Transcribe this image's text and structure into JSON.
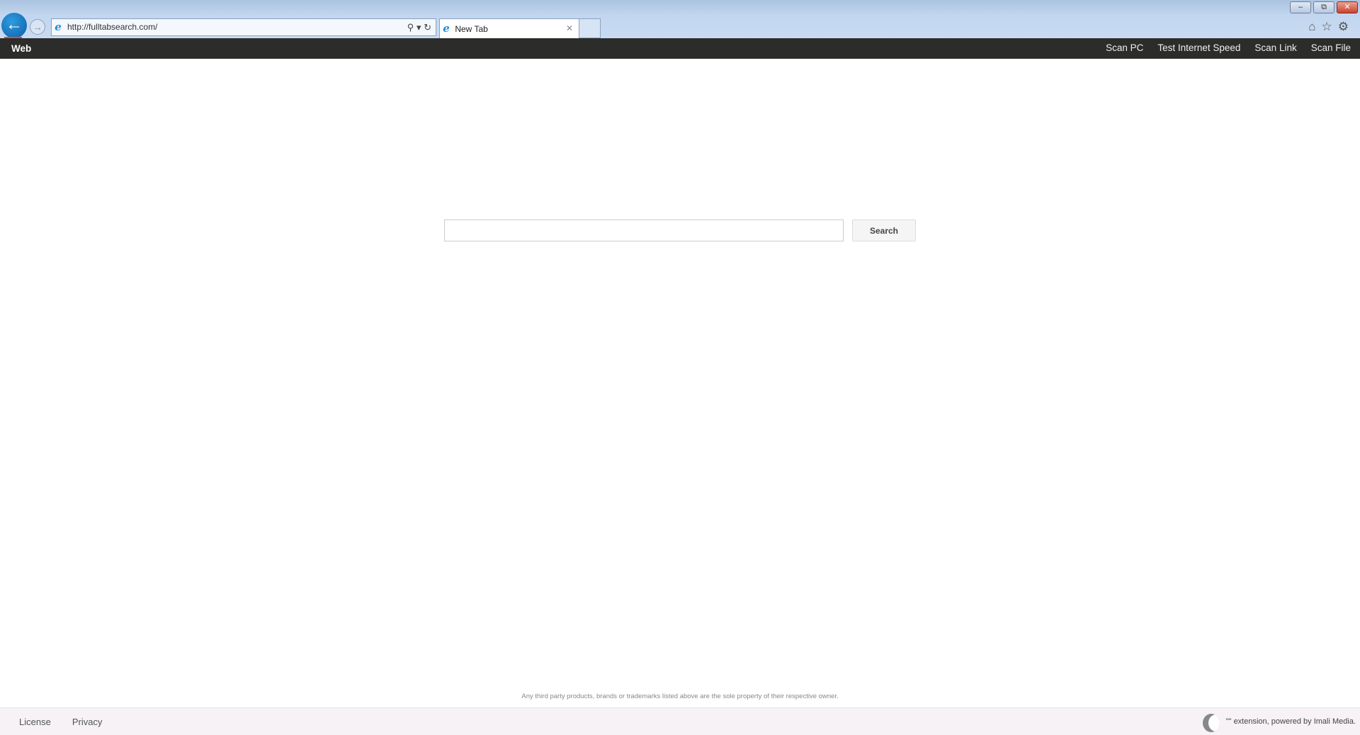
{
  "browser": {
    "url": "http://fulltabsearch.com/",
    "tab_title": "New Tab",
    "icons": [
      "back-icon",
      "forward-icon",
      "ie-icon",
      "search-icon",
      "refresh-icon",
      "close-icon",
      "home-icon",
      "star-icon",
      "gear-icon",
      "minimize-icon",
      "restore-icon",
      "window-close-icon"
    ]
  },
  "nav": {
    "brand": "Web",
    "links": [
      "Scan PC",
      "Test Internet Speed",
      "Scan Link",
      "Scan File"
    ]
  },
  "search": {
    "value": "",
    "button": "Search"
  },
  "disclaimer": "Any third party products, brands or trademarks listed above are the sole property of their respective owner.",
  "footer": {
    "links": [
      "License",
      "Privacy"
    ],
    "credit": "\"\" extension, powered by Imali Media."
  },
  "colors": {
    "nav_bg": "#2c2d2b",
    "footer_bg": "#f6f2f5",
    "accent": "#e04a3a"
  }
}
